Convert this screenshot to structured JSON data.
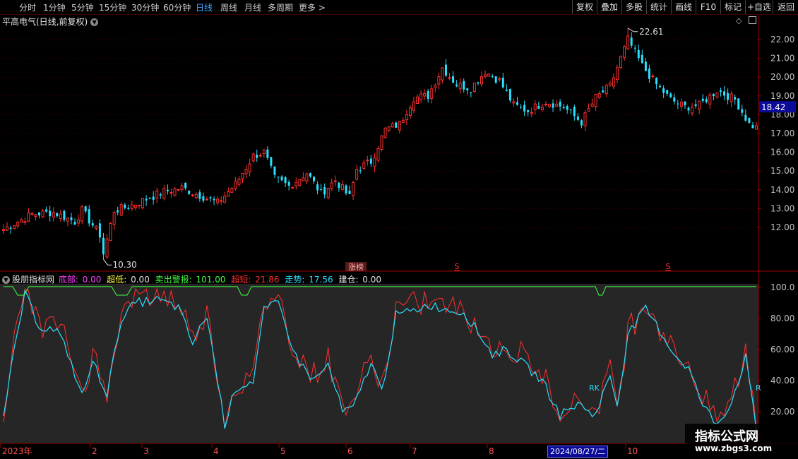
{
  "toolbar": {
    "periods": [
      "分时",
      "1分钟",
      "5分钟",
      "15分钟",
      "30分钟",
      "60分钟",
      "日线",
      "周线",
      "月线",
      "多周期",
      "更多"
    ],
    "active_period": "日线",
    "right_buttons": [
      "复权",
      "叠加",
      "多股",
      "统计",
      "画线",
      "F10",
      "标记",
      "+自选",
      "返回"
    ]
  },
  "chart": {
    "title": "平高电气(日线,前复权)",
    "current_price": "18.42",
    "high_label": "22.61",
    "low_label": "10.30",
    "event_marker": "涨榜",
    "s_marker": "S",
    "price_axis": [
      "22.00",
      "21.00",
      "20.00",
      "19.00",
      "18.00",
      "17.00",
      "16.00",
      "15.00",
      "14.00",
      "13.00",
      "12.00"
    ],
    "indicator_axis": [
      "100.0",
      "80.00",
      "60.00",
      "40.00",
      "20.00"
    ],
    "rk_label": "RK",
    "rk_label_right": "R",
    "colors": {
      "up": "#ff3030",
      "down": "#28e0ff",
      "grid": "#4a0000",
      "axis": "#a00000",
      "ind_bg": "#262626"
    }
  },
  "indicator": {
    "name": "股朋指标网",
    "items": [
      {
        "label": "底部: ",
        "value": "0.00",
        "color": "#ff40ff"
      },
      {
        "label": "超低: ",
        "value": "0.00",
        "color": "#ffff40"
      },
      {
        "label": "卖出警报: ",
        "value": "101.00",
        "color": "#40ff40"
      },
      {
        "label": "超短: ",
        "value": "21.86",
        "color": "#ff3030"
      },
      {
        "label": "走势: ",
        "value": "17.56",
        "color": "#28e0ff"
      },
      {
        "label": "建仓: ",
        "value": "0.00",
        "color": "#e0e0e0"
      }
    ]
  },
  "xaxis": {
    "labels": [
      "2023年",
      "2",
      "3",
      "4",
      "5",
      "6",
      "7",
      "8",
      "10"
    ],
    "cursor_date": "2024/08/27/二"
  },
  "watermark": {
    "line1": "指标公式网",
    "line2": "www.zbgs3.com"
  }
}
